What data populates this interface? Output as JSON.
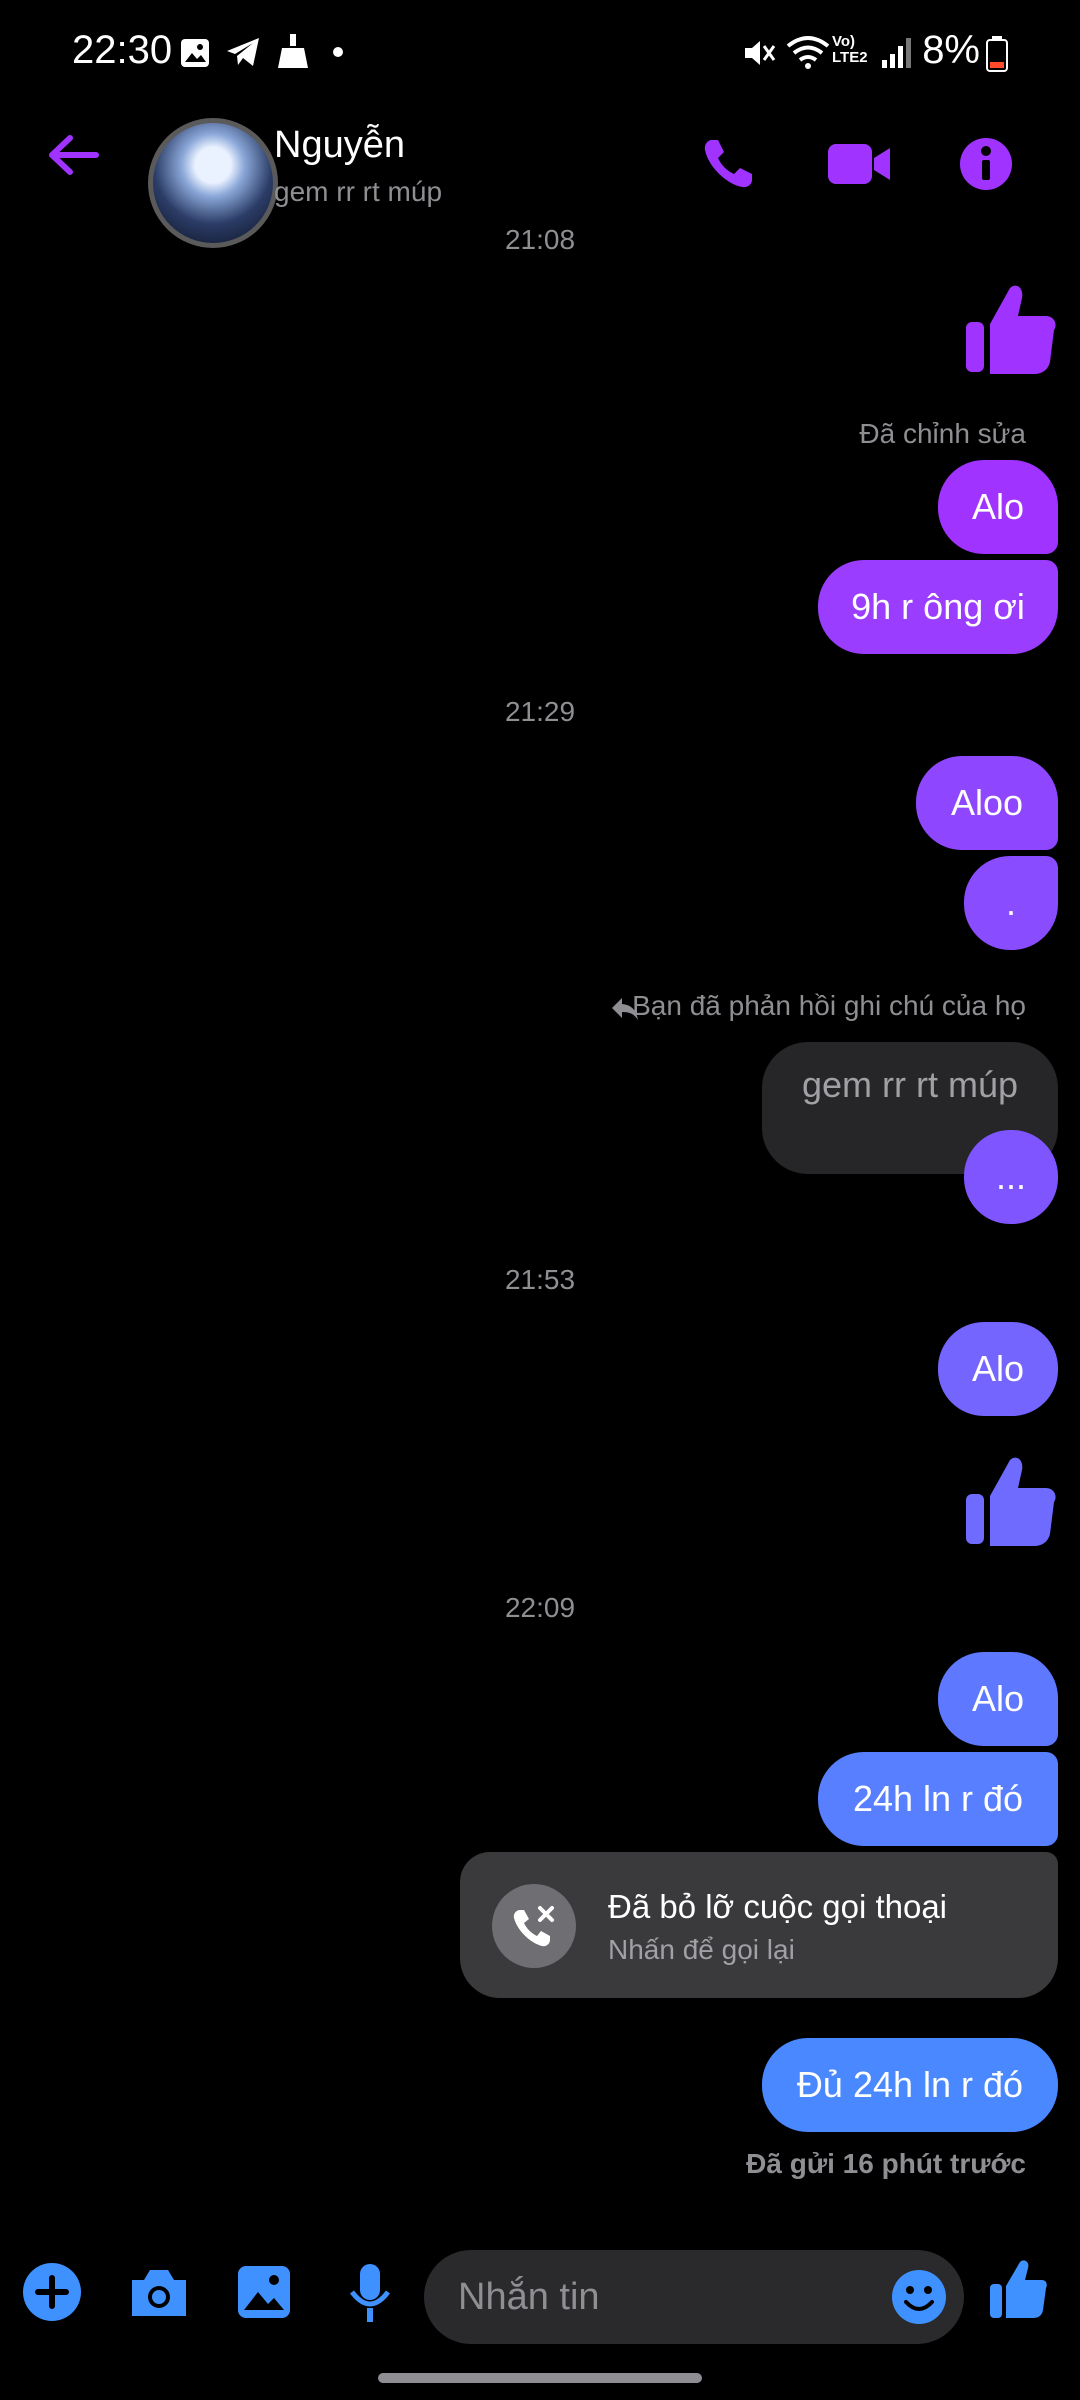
{
  "status_bar": {
    "time": "22:30",
    "battery": "8%",
    "network_label": "LTE2"
  },
  "header": {
    "name": "Nguyễn",
    "status_text": "gem rr rt múp",
    "colors": {
      "accent": "#a033ff"
    }
  },
  "messages": {
    "ts_partial": "21:08",
    "edited_label": "Đã chỉnh sửa",
    "m1": "Alo",
    "m2": "9h r ông ơi",
    "ts1": "21:29",
    "m3": "Aloo",
    "m4": ".",
    "reply_label": "Bạn đã phản hồi ghi chú của họ",
    "note_text": "gem rr rt múp",
    "m5": "...",
    "ts2": "21:53",
    "m6": "Alo",
    "ts3": "22:09",
    "m7": "Alo",
    "m8": "24h ln r đó",
    "missed_call_title": "Đã bỏ lỡ cuộc gọi thoại",
    "missed_call_sub": "Nhấn để gọi lại",
    "m9": "Đủ 24h ln r đó",
    "sent_status": "Đã gửi 16 phút trước"
  },
  "composer": {
    "placeholder": "Nhắn tin"
  },
  "colors": {
    "bubble_purple": "#a033ff",
    "bubble_violet": "#7a55ff",
    "bubble_blue": "#4f86ff",
    "composer_blue": "#3f91ff"
  }
}
